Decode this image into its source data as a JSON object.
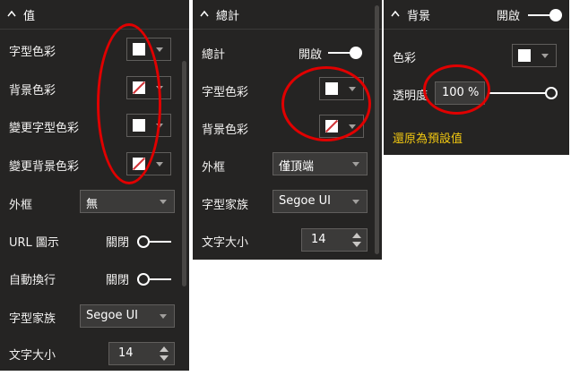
{
  "panel1": {
    "title": "值",
    "font_color_label": "字型色彩",
    "bg_color_label": "背景色彩",
    "cond_font_color_label": "變更字型色彩",
    "cond_bg_color_label": "變更背景色彩",
    "border_label": "外框",
    "border_value": "無",
    "url_icon_label": "URL 圖示",
    "url_icon_state": "關閉",
    "word_wrap_label": "自動換行",
    "word_wrap_state": "關閉",
    "font_family_label": "字型家族",
    "font_family_value": "Segoe UI",
    "text_size_label": "文字大小",
    "text_size_value": "14"
  },
  "panel2": {
    "title": "總計",
    "total_label": "總計",
    "total_state": "開啟",
    "font_color_label": "字型色彩",
    "bg_color_label": "背景色彩",
    "border_label": "外框",
    "border_value": "僅頂端",
    "font_family_label": "字型家族",
    "font_family_value": "Segoe UI",
    "text_size_label": "文字大小",
    "text_size_value": "14"
  },
  "panel3": {
    "title": "背景",
    "state": "開啟",
    "color_label": "色彩",
    "transparency_label": "透明度",
    "transparency_value": "100 %",
    "transparency_level": 1.0,
    "reset_link": "還原為預設值"
  },
  "colors": {
    "panel_bg": "#252423",
    "annotation_red": "#e00000",
    "link_yellow": "#f2c811",
    "no_fill_slash": "#d13438"
  },
  "icons": {
    "collapse": "chevron-up-icon",
    "dropdown": "caret-down-icon",
    "no_fill": "no-fill-swatch-icon"
  }
}
